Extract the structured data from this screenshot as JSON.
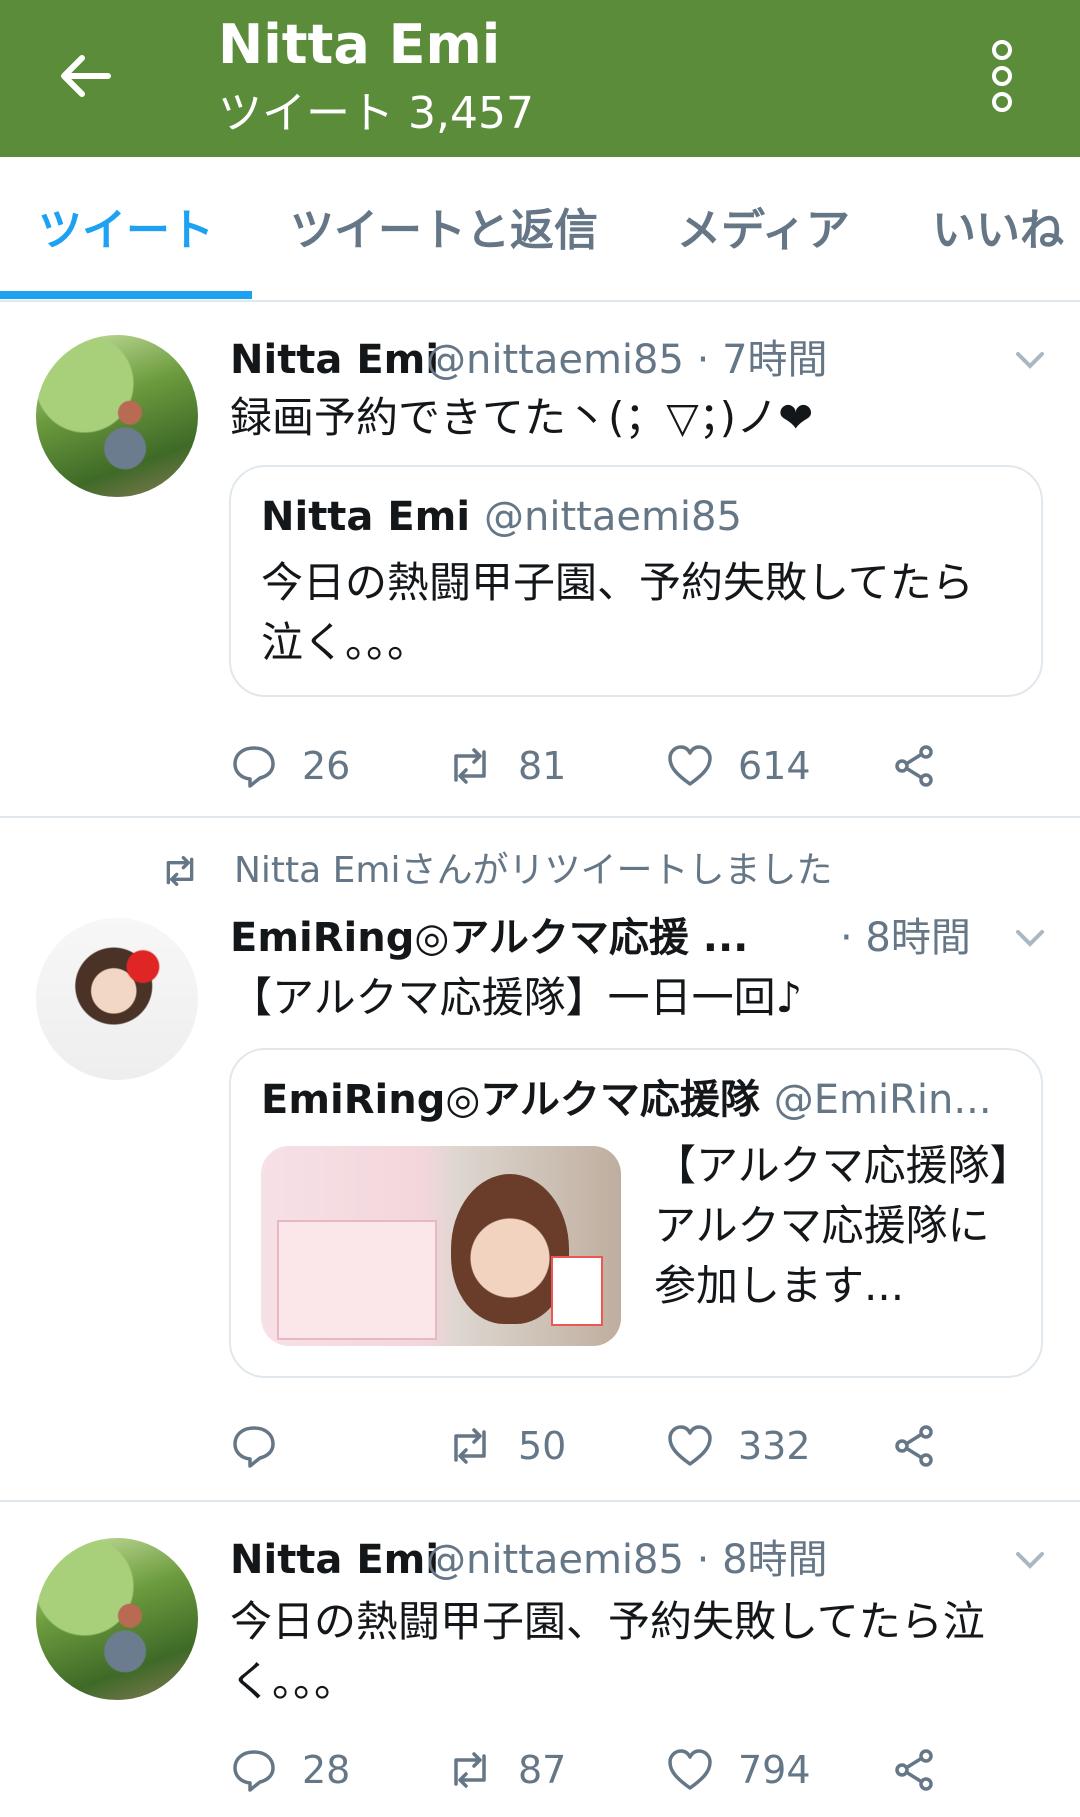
{
  "header": {
    "title": "Nitta Emi",
    "subtitle": "ツイート 3,457"
  },
  "tabs": [
    "ツイート",
    "ツイートと返信",
    "メディア",
    "いいね"
  ],
  "tweets": [
    {
      "name": "Nitta Emi",
      "handle": "@nittaemi85 · 7時間",
      "text": "録画予約できてた丶(；▽；)ノ❤",
      "quote": {
        "name": "Nitta Emi",
        "handle": "@nittaemi85",
        "text": "今日の熱闘甲子園、予約失敗してたら泣く。。。"
      },
      "replies": "26",
      "retweets": "81",
      "likes": "614"
    },
    {
      "retweet_note": "Nitta Emiさんがリツイートしました",
      "name": "EmiRing◎アルクマ応援 ...",
      "handle": "· 8時間",
      "text": "【アルクマ応援隊】一日一回♪",
      "quote": {
        "name": "EmiRing◎アルクマ応援隊",
        "handle": "@EmiRin...",
        "text": "【アルクマ応援隊】アルクマ応援隊に参加します..."
      },
      "replies": "",
      "retweets": "50",
      "likes": "332"
    },
    {
      "name": "Nitta Emi",
      "handle": "@nittaemi85 · 8時間",
      "text": "今日の熱闘甲子園、予約失敗してたら泣く。。。",
      "replies": "28",
      "retweets": "87",
      "likes": "794"
    }
  ],
  "colors": {
    "header_bg": "#5b8c3a",
    "accent": "#1da1f2",
    "muted": "#657786"
  }
}
